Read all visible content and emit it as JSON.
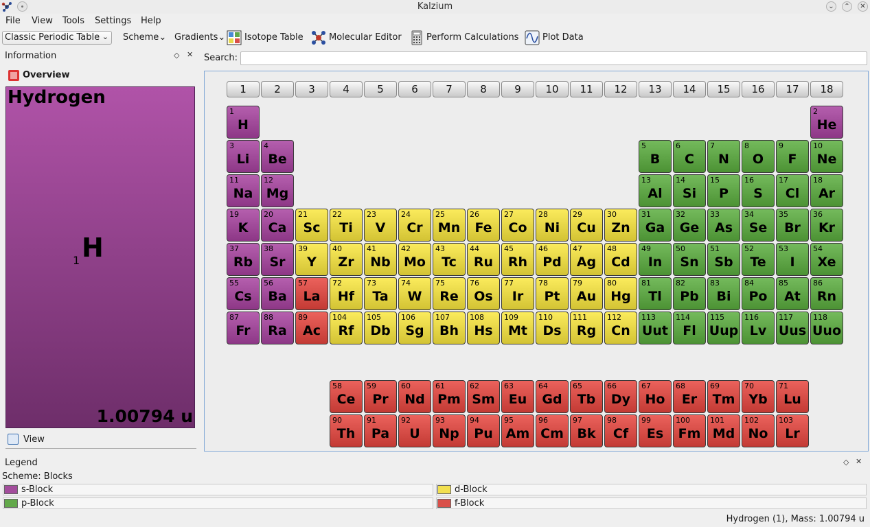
{
  "window": {
    "title": "Kalzium",
    "controls": [
      "⌄",
      "⌃",
      "✕"
    ]
  },
  "menu": [
    "File",
    "View",
    "Tools",
    "Settings",
    "Help"
  ],
  "toolbar": {
    "table_select": "Classic Periodic Table",
    "scheme": "Scheme",
    "gradients": "Gradients",
    "isotope_table": "Isotope Table",
    "molecular_editor": "Molecular Editor",
    "perform_calculations": "Perform Calculations",
    "plot_data": "Plot Data"
  },
  "info_panel": {
    "title": "Information",
    "overview": "Overview",
    "view_tab": "View",
    "element": {
      "name": "Hydrogen",
      "symbol": "H",
      "number": "1",
      "mass": "1.00794 u"
    }
  },
  "search": {
    "label": "Search:",
    "value": ""
  },
  "groups": [
    "1",
    "2",
    "3",
    "4",
    "5",
    "6",
    "7",
    "8",
    "9",
    "10",
    "11",
    "12",
    "13",
    "14",
    "15",
    "16",
    "17",
    "18"
  ],
  "colors": {
    "s": "#a34d9c",
    "p": "#62a84a",
    "d": "#e9d94a",
    "f": "#d9504a"
  },
  "elements": [
    {
      "n": "1",
      "s": "H",
      "c": 1,
      "r": 1,
      "b": "s"
    },
    {
      "n": "2",
      "s": "He",
      "c": 18,
      "r": 1,
      "b": "s"
    },
    {
      "n": "3",
      "s": "Li",
      "c": 1,
      "r": 2,
      "b": "s"
    },
    {
      "n": "4",
      "s": "Be",
      "c": 2,
      "r": 2,
      "b": "s"
    },
    {
      "n": "5",
      "s": "B",
      "c": 13,
      "r": 2,
      "b": "p"
    },
    {
      "n": "6",
      "s": "C",
      "c": 14,
      "r": 2,
      "b": "p"
    },
    {
      "n": "7",
      "s": "N",
      "c": 15,
      "r": 2,
      "b": "p"
    },
    {
      "n": "8",
      "s": "O",
      "c": 16,
      "r": 2,
      "b": "p"
    },
    {
      "n": "9",
      "s": "F",
      "c": 17,
      "r": 2,
      "b": "p"
    },
    {
      "n": "10",
      "s": "Ne",
      "c": 18,
      "r": 2,
      "b": "p"
    },
    {
      "n": "11",
      "s": "Na",
      "c": 1,
      "r": 3,
      "b": "s"
    },
    {
      "n": "12",
      "s": "Mg",
      "c": 2,
      "r": 3,
      "b": "s"
    },
    {
      "n": "13",
      "s": "Al",
      "c": 13,
      "r": 3,
      "b": "p"
    },
    {
      "n": "14",
      "s": "Si",
      "c": 14,
      "r": 3,
      "b": "p"
    },
    {
      "n": "15",
      "s": "P",
      "c": 15,
      "r": 3,
      "b": "p"
    },
    {
      "n": "16",
      "s": "S",
      "c": 16,
      "r": 3,
      "b": "p"
    },
    {
      "n": "17",
      "s": "Cl",
      "c": 17,
      "r": 3,
      "b": "p"
    },
    {
      "n": "18",
      "s": "Ar",
      "c": 18,
      "r": 3,
      "b": "p"
    },
    {
      "n": "19",
      "s": "K",
      "c": 1,
      "r": 4,
      "b": "s"
    },
    {
      "n": "20",
      "s": "Ca",
      "c": 2,
      "r": 4,
      "b": "s"
    },
    {
      "n": "21",
      "s": "Sc",
      "c": 3,
      "r": 4,
      "b": "d"
    },
    {
      "n": "22",
      "s": "Ti",
      "c": 4,
      "r": 4,
      "b": "d"
    },
    {
      "n": "23",
      "s": "V",
      "c": 5,
      "r": 4,
      "b": "d"
    },
    {
      "n": "24",
      "s": "Cr",
      "c": 6,
      "r": 4,
      "b": "d"
    },
    {
      "n": "25",
      "s": "Mn",
      "c": 7,
      "r": 4,
      "b": "d"
    },
    {
      "n": "26",
      "s": "Fe",
      "c": 8,
      "r": 4,
      "b": "d"
    },
    {
      "n": "27",
      "s": "Co",
      "c": 9,
      "r": 4,
      "b": "d"
    },
    {
      "n": "28",
      "s": "Ni",
      "c": 10,
      "r": 4,
      "b": "d"
    },
    {
      "n": "29",
      "s": "Cu",
      "c": 11,
      "r": 4,
      "b": "d"
    },
    {
      "n": "30",
      "s": "Zn",
      "c": 12,
      "r": 4,
      "b": "d"
    },
    {
      "n": "31",
      "s": "Ga",
      "c": 13,
      "r": 4,
      "b": "p"
    },
    {
      "n": "32",
      "s": "Ge",
      "c": 14,
      "r": 4,
      "b": "p"
    },
    {
      "n": "33",
      "s": "As",
      "c": 15,
      "r": 4,
      "b": "p"
    },
    {
      "n": "34",
      "s": "Se",
      "c": 16,
      "r": 4,
      "b": "p"
    },
    {
      "n": "35",
      "s": "Br",
      "c": 17,
      "r": 4,
      "b": "p"
    },
    {
      "n": "36",
      "s": "Kr",
      "c": 18,
      "r": 4,
      "b": "p"
    },
    {
      "n": "37",
      "s": "Rb",
      "c": 1,
      "r": 5,
      "b": "s"
    },
    {
      "n": "38",
      "s": "Sr",
      "c": 2,
      "r": 5,
      "b": "s"
    },
    {
      "n": "39",
      "s": "Y",
      "c": 3,
      "r": 5,
      "b": "d"
    },
    {
      "n": "40",
      "s": "Zr",
      "c": 4,
      "r": 5,
      "b": "d"
    },
    {
      "n": "41",
      "s": "Nb",
      "c": 5,
      "r": 5,
      "b": "d"
    },
    {
      "n": "42",
      "s": "Mo",
      "c": 6,
      "r": 5,
      "b": "d"
    },
    {
      "n": "43",
      "s": "Tc",
      "c": 7,
      "r": 5,
      "b": "d"
    },
    {
      "n": "44",
      "s": "Ru",
      "c": 8,
      "r": 5,
      "b": "d"
    },
    {
      "n": "45",
      "s": "Rh",
      "c": 9,
      "r": 5,
      "b": "d"
    },
    {
      "n": "46",
      "s": "Pd",
      "c": 10,
      "r": 5,
      "b": "d"
    },
    {
      "n": "47",
      "s": "Ag",
      "c": 11,
      "r": 5,
      "b": "d"
    },
    {
      "n": "48",
      "s": "Cd",
      "c": 12,
      "r": 5,
      "b": "d"
    },
    {
      "n": "49",
      "s": "In",
      "c": 13,
      "r": 5,
      "b": "p"
    },
    {
      "n": "50",
      "s": "Sn",
      "c": 14,
      "r": 5,
      "b": "p"
    },
    {
      "n": "51",
      "s": "Sb",
      "c": 15,
      "r": 5,
      "b": "p"
    },
    {
      "n": "52",
      "s": "Te",
      "c": 16,
      "r": 5,
      "b": "p"
    },
    {
      "n": "53",
      "s": "I",
      "c": 17,
      "r": 5,
      "b": "p"
    },
    {
      "n": "54",
      "s": "Xe",
      "c": 18,
      "r": 5,
      "b": "p"
    },
    {
      "n": "55",
      "s": "Cs",
      "c": 1,
      "r": 6,
      "b": "s"
    },
    {
      "n": "56",
      "s": "Ba",
      "c": 2,
      "r": 6,
      "b": "s"
    },
    {
      "n": "57",
      "s": "La",
      "c": 3,
      "r": 6,
      "b": "f"
    },
    {
      "n": "72",
      "s": "Hf",
      "c": 4,
      "r": 6,
      "b": "d"
    },
    {
      "n": "73",
      "s": "Ta",
      "c": 5,
      "r": 6,
      "b": "d"
    },
    {
      "n": "74",
      "s": "W",
      "c": 6,
      "r": 6,
      "b": "d"
    },
    {
      "n": "75",
      "s": "Re",
      "c": 7,
      "r": 6,
      "b": "d"
    },
    {
      "n": "76",
      "s": "Os",
      "c": 8,
      "r": 6,
      "b": "d"
    },
    {
      "n": "77",
      "s": "Ir",
      "c": 9,
      "r": 6,
      "b": "d"
    },
    {
      "n": "78",
      "s": "Pt",
      "c": 10,
      "r": 6,
      "b": "d"
    },
    {
      "n": "79",
      "s": "Au",
      "c": 11,
      "r": 6,
      "b": "d"
    },
    {
      "n": "80",
      "s": "Hg",
      "c": 12,
      "r": 6,
      "b": "d"
    },
    {
      "n": "81",
      "s": "Tl",
      "c": 13,
      "r": 6,
      "b": "p"
    },
    {
      "n": "82",
      "s": "Pb",
      "c": 14,
      "r": 6,
      "b": "p"
    },
    {
      "n": "83",
      "s": "Bi",
      "c": 15,
      "r": 6,
      "b": "p"
    },
    {
      "n": "84",
      "s": "Po",
      "c": 16,
      "r": 6,
      "b": "p"
    },
    {
      "n": "85",
      "s": "At",
      "c": 17,
      "r": 6,
      "b": "p"
    },
    {
      "n": "86",
      "s": "Rn",
      "c": 18,
      "r": 6,
      "b": "p"
    },
    {
      "n": "87",
      "s": "Fr",
      "c": 1,
      "r": 7,
      "b": "s"
    },
    {
      "n": "88",
      "s": "Ra",
      "c": 2,
      "r": 7,
      "b": "s"
    },
    {
      "n": "89",
      "s": "Ac",
      "c": 3,
      "r": 7,
      "b": "f"
    },
    {
      "n": "104",
      "s": "Rf",
      "c": 4,
      "r": 7,
      "b": "d"
    },
    {
      "n": "105",
      "s": "Db",
      "c": 5,
      "r": 7,
      "b": "d"
    },
    {
      "n": "106",
      "s": "Sg",
      "c": 6,
      "r": 7,
      "b": "d"
    },
    {
      "n": "107",
      "s": "Bh",
      "c": 7,
      "r": 7,
      "b": "d"
    },
    {
      "n": "108",
      "s": "Hs",
      "c": 8,
      "r": 7,
      "b": "d"
    },
    {
      "n": "109",
      "s": "Mt",
      "c": 9,
      "r": 7,
      "b": "d"
    },
    {
      "n": "110",
      "s": "Ds",
      "c": 10,
      "r": 7,
      "b": "d"
    },
    {
      "n": "111",
      "s": "Rg",
      "c": 11,
      "r": 7,
      "b": "d"
    },
    {
      "n": "112",
      "s": "Cn",
      "c": 12,
      "r": 7,
      "b": "d"
    },
    {
      "n": "113",
      "s": "Uut",
      "c": 13,
      "r": 7,
      "b": "p"
    },
    {
      "n": "114",
      "s": "Fl",
      "c": 14,
      "r": 7,
      "b": "p"
    },
    {
      "n": "115",
      "s": "Uup",
      "c": 15,
      "r": 7,
      "b": "p"
    },
    {
      "n": "116",
      "s": "Lv",
      "c": 16,
      "r": 7,
      "b": "p"
    },
    {
      "n": "117",
      "s": "Uus",
      "c": 17,
      "r": 7,
      "b": "p"
    },
    {
      "n": "118",
      "s": "Uuo",
      "c": 18,
      "r": 7,
      "b": "p"
    },
    {
      "n": "58",
      "s": "Ce",
      "c": 4,
      "r": 9,
      "b": "f"
    },
    {
      "n": "59",
      "s": "Pr",
      "c": 5,
      "r": 9,
      "b": "f"
    },
    {
      "n": "60",
      "s": "Nd",
      "c": 6,
      "r": 9,
      "b": "f"
    },
    {
      "n": "61",
      "s": "Pm",
      "c": 7,
      "r": 9,
      "b": "f"
    },
    {
      "n": "62",
      "s": "Sm",
      "c": 8,
      "r": 9,
      "b": "f"
    },
    {
      "n": "63",
      "s": "Eu",
      "c": 9,
      "r": 9,
      "b": "f"
    },
    {
      "n": "64",
      "s": "Gd",
      "c": 10,
      "r": 9,
      "b": "f"
    },
    {
      "n": "65",
      "s": "Tb",
      "c": 11,
      "r": 9,
      "b": "f"
    },
    {
      "n": "66",
      "s": "Dy",
      "c": 12,
      "r": 9,
      "b": "f"
    },
    {
      "n": "67",
      "s": "Ho",
      "c": 13,
      "r": 9,
      "b": "f"
    },
    {
      "n": "68",
      "s": "Er",
      "c": 14,
      "r": 9,
      "b": "f"
    },
    {
      "n": "69",
      "s": "Tm",
      "c": 15,
      "r": 9,
      "b": "f"
    },
    {
      "n": "70",
      "s": "Yb",
      "c": 16,
      "r": 9,
      "b": "f"
    },
    {
      "n": "71",
      "s": "Lu",
      "c": 17,
      "r": 9,
      "b": "f"
    },
    {
      "n": "90",
      "s": "Th",
      "c": 4,
      "r": 10,
      "b": "f"
    },
    {
      "n": "91",
      "s": "Pa",
      "c": 5,
      "r": 10,
      "b": "f"
    },
    {
      "n": "92",
      "s": "U",
      "c": 6,
      "r": 10,
      "b": "f"
    },
    {
      "n": "93",
      "s": "Np",
      "c": 7,
      "r": 10,
      "b": "f"
    },
    {
      "n": "94",
      "s": "Pu",
      "c": 8,
      "r": 10,
      "b": "f"
    },
    {
      "n": "95",
      "s": "Am",
      "c": 9,
      "r": 10,
      "b": "f"
    },
    {
      "n": "96",
      "s": "Cm",
      "c": 10,
      "r": 10,
      "b": "f"
    },
    {
      "n": "97",
      "s": "Bk",
      "c": 11,
      "r": 10,
      "b": "f"
    },
    {
      "n": "98",
      "s": "Cf",
      "c": 12,
      "r": 10,
      "b": "f"
    },
    {
      "n": "99",
      "s": "Es",
      "c": 13,
      "r": 10,
      "b": "f"
    },
    {
      "n": "100",
      "s": "Fm",
      "c": 14,
      "r": 10,
      "b": "f"
    },
    {
      "n": "101",
      "s": "Md",
      "c": 15,
      "r": 10,
      "b": "f"
    },
    {
      "n": "102",
      "s": "No",
      "c": 16,
      "r": 10,
      "b": "f"
    },
    {
      "n": "103",
      "s": "Lr",
      "c": 17,
      "r": 10,
      "b": "f"
    }
  ],
  "legend": {
    "title": "Legend",
    "scheme": "Scheme: Blocks",
    "items": [
      {
        "label": "s-Block",
        "color": "#a34d9c"
      },
      {
        "label": "d-Block",
        "color": "#f2e050"
      },
      {
        "label": "p-Block",
        "color": "#62a84a"
      },
      {
        "label": "f-Block",
        "color": "#d9504a"
      }
    ]
  },
  "status": "Hydrogen (1), Mass: 1.00794 u"
}
